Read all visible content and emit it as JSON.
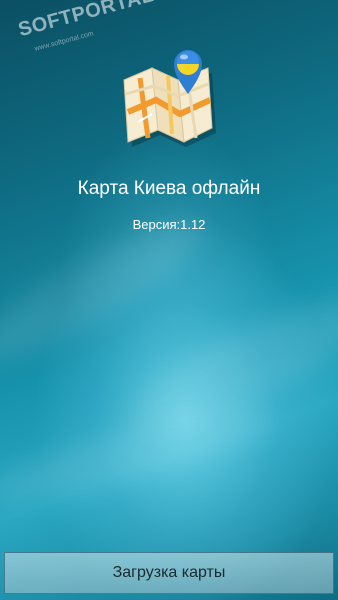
{
  "watermark": {
    "brand": "SOFTPORTAL",
    "trademark": "™",
    "url": "www.softportal.com"
  },
  "icons": {
    "app_icon": "kyiv-map-pin-icon"
  },
  "app": {
    "title": "Карта Киева офлайн",
    "version": "Версия:1.12"
  },
  "actions": {
    "download_label": "Загрузка карты"
  },
  "colors": {
    "background_dark": "#0b4f63",
    "background_light": "#2aa8c3",
    "pin_blue": "#3a8ee6",
    "pin_yellow": "#f5d628",
    "map_paper": "#f3e6c8",
    "map_road": "#f29a2e"
  }
}
